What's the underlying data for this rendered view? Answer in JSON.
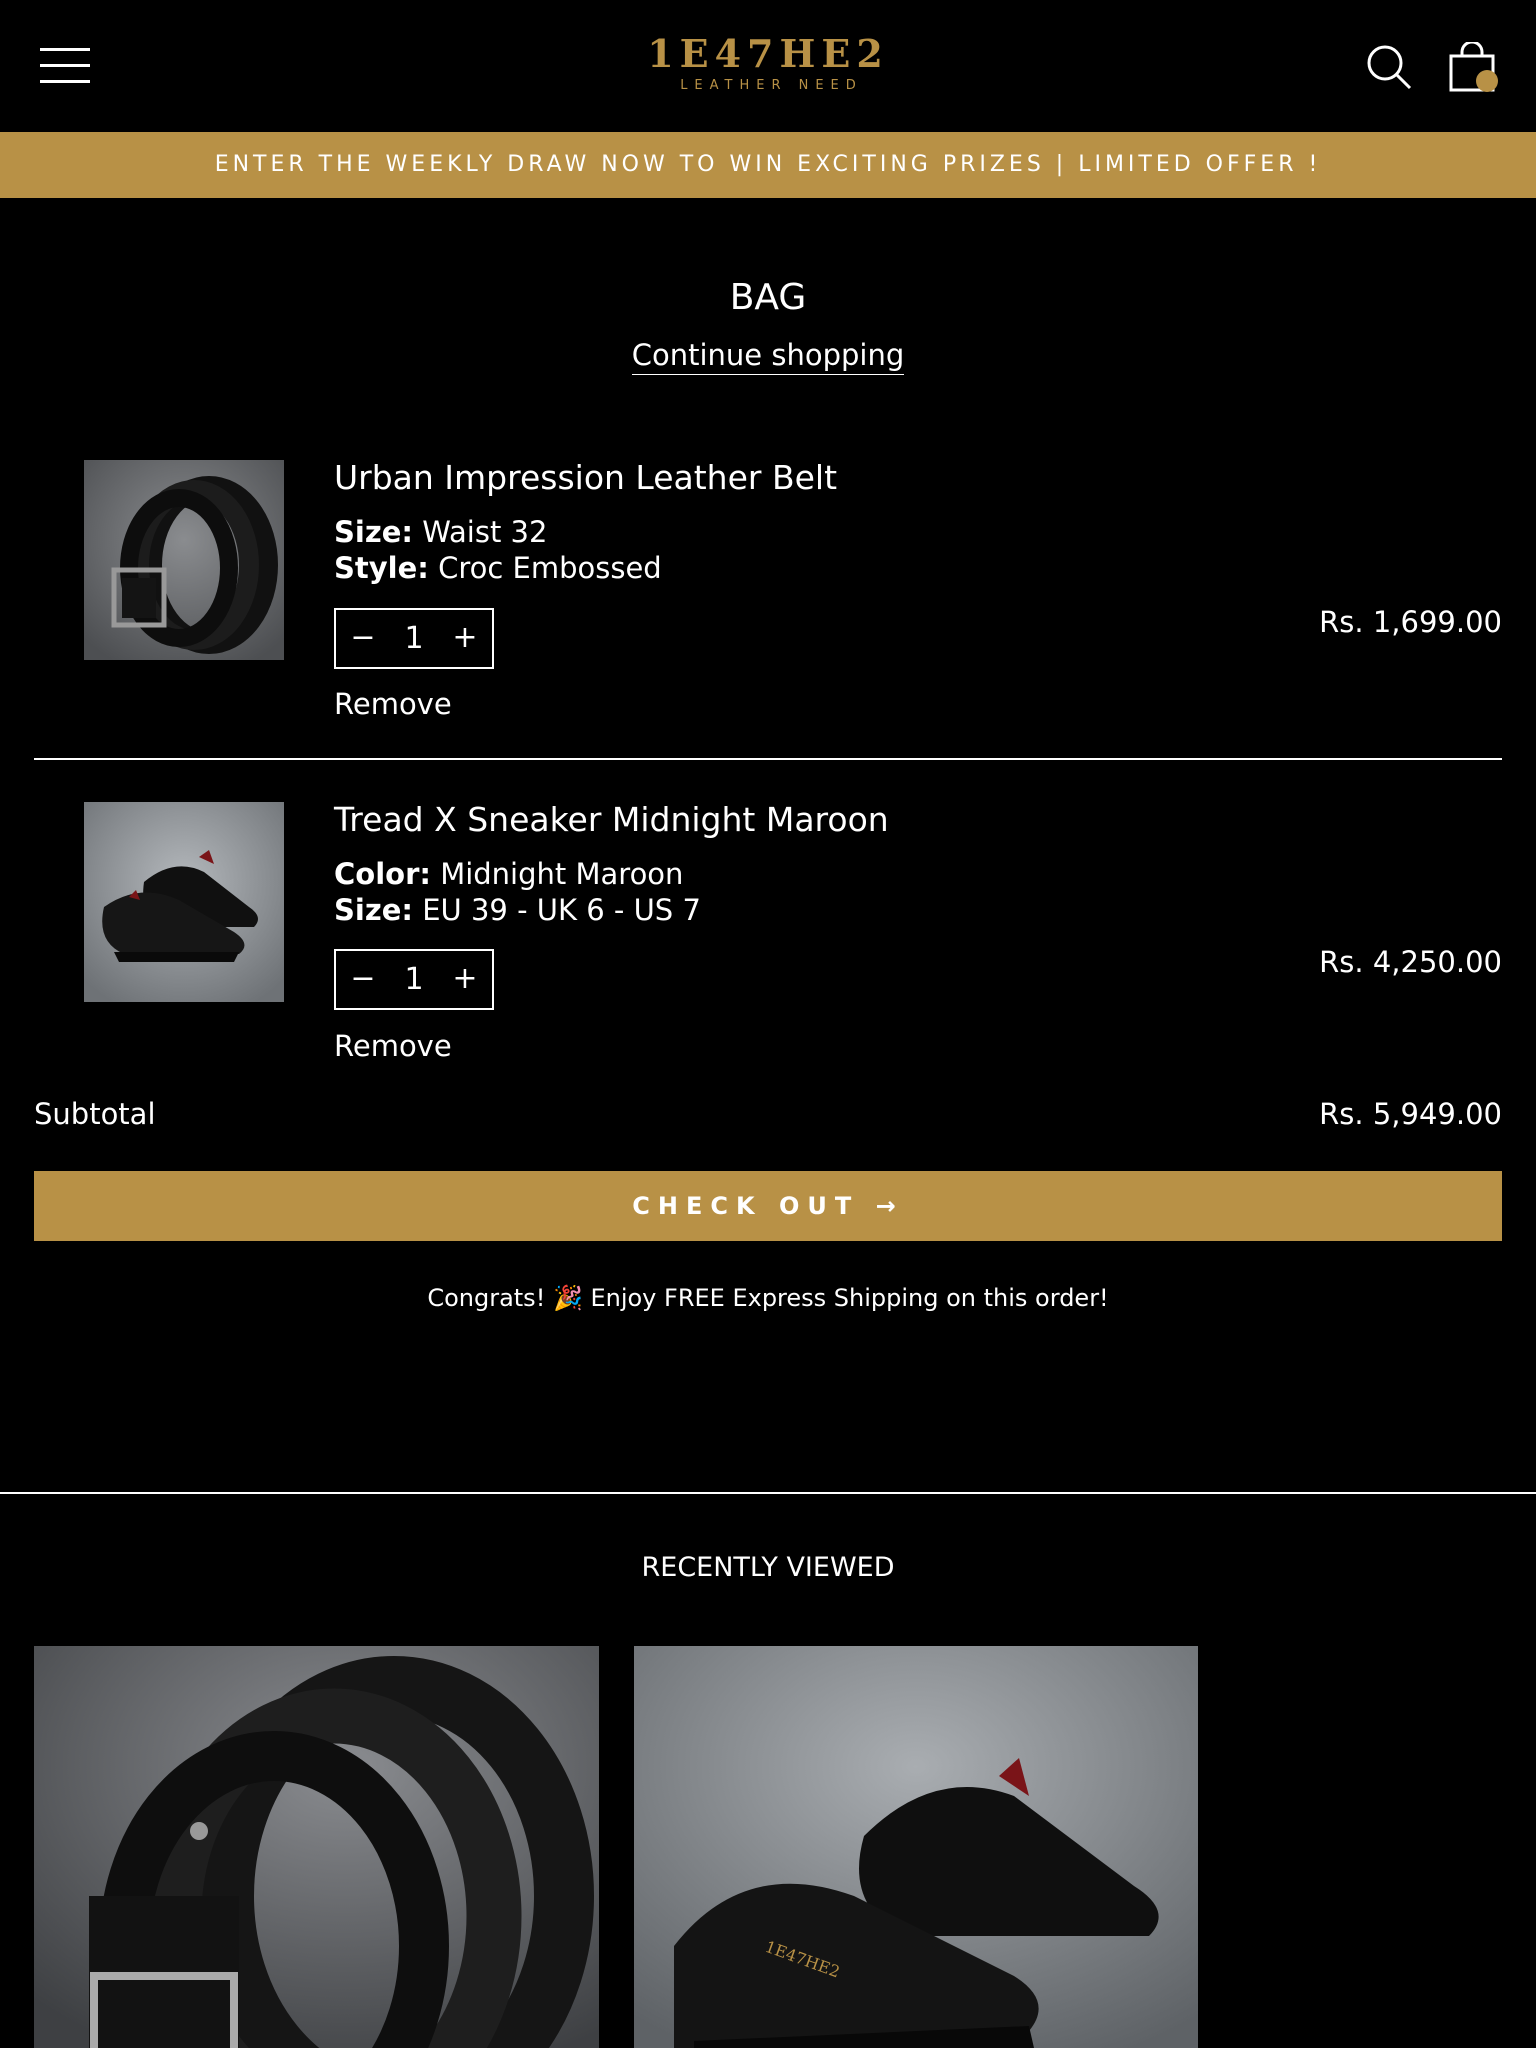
{
  "header": {
    "logo_main": "1E47HE2",
    "logo_sub": "LEATHER NEED",
    "menu_icon": "hamburger-menu-icon",
    "search_icon": "search-icon",
    "bag_icon": "shopping-bag-icon"
  },
  "promo_banner": "ENTER THE WEEKLY DRAW NOW TO WIN EXCITING PRIZES | LIMITED OFFER !",
  "page": {
    "title": "BAG",
    "continue_link": "Continue shopping"
  },
  "cart": {
    "items": [
      {
        "name": "Urban Impression Leather Belt",
        "options": [
          {
            "label": "Size:",
            "value": "Waist 32"
          },
          {
            "label": "Style:",
            "value": "Croc Embossed"
          }
        ],
        "quantity": "1",
        "decrement": "−",
        "increment": "+",
        "remove": "Remove",
        "price": "Rs. 1,699.00"
      },
      {
        "name": "Tread X Sneaker Midnight Maroon",
        "options": [
          {
            "label": "Color:",
            "value": "Midnight Maroon"
          },
          {
            "label": "Size:",
            "value": "EU 39 - UK 6 - US 7"
          }
        ],
        "quantity": "1",
        "decrement": "−",
        "increment": "+",
        "remove": "Remove",
        "price": "Rs. 4,250.00"
      }
    ],
    "subtotal_label": "Subtotal",
    "subtotal_value": "Rs. 5,949.00",
    "checkout_label": "CHECK OUT →",
    "shipping_note": "Congrats! 🎉 Enjoy FREE Express Shipping on this order!"
  },
  "recently_viewed": {
    "title": "RECENTLY VIEWED"
  },
  "colors": {
    "background": "#000000",
    "accent_gold": "#b89146",
    "text": "#ffffff"
  }
}
